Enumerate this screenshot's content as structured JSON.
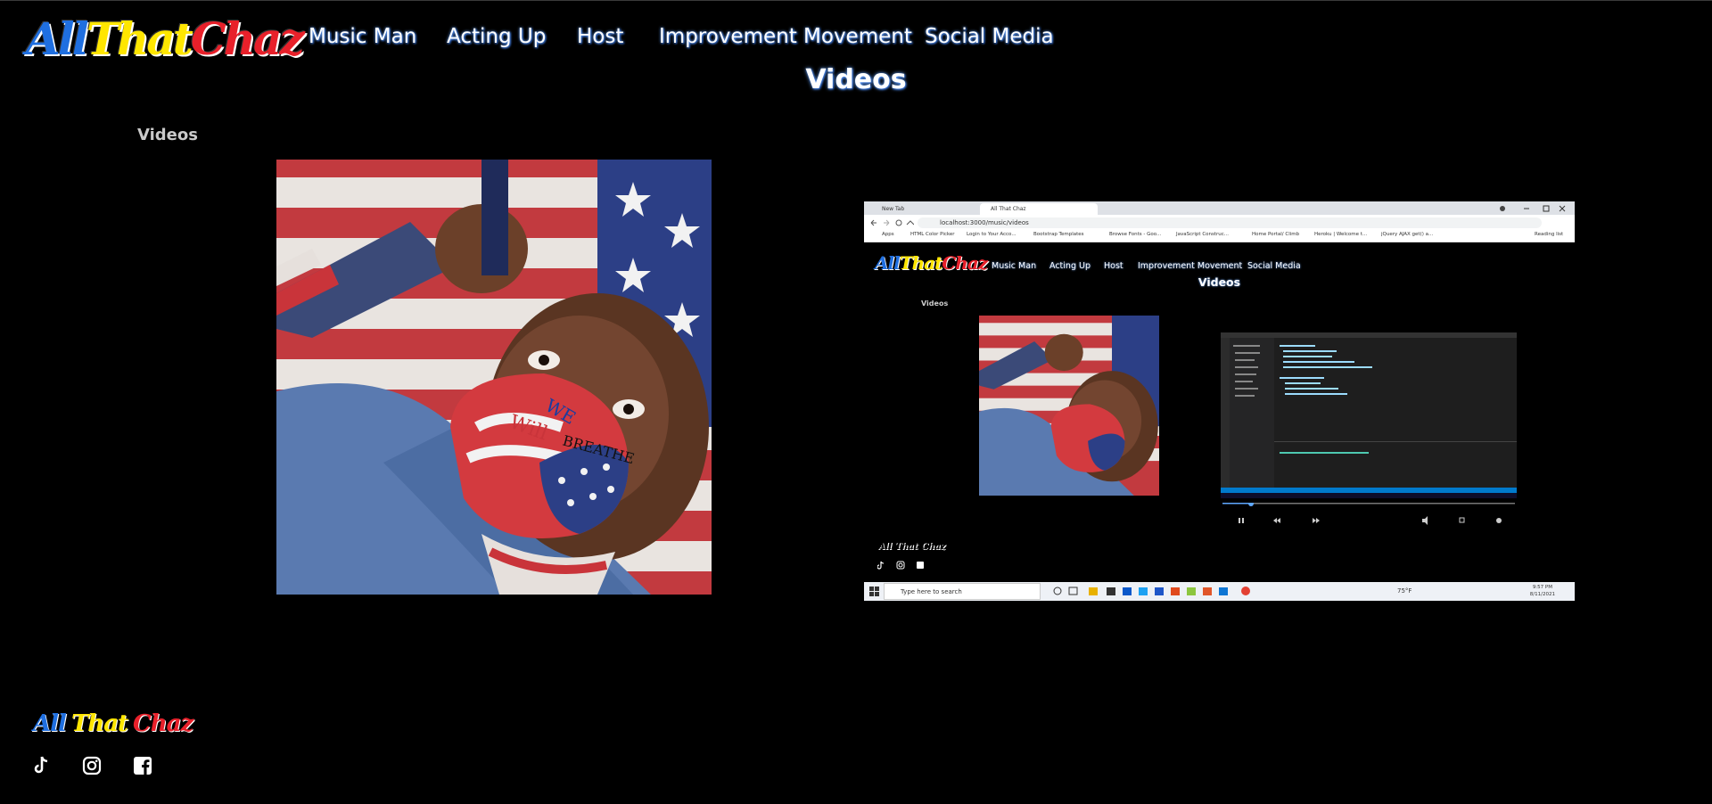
{
  "brand": {
    "part1": "All",
    "part2": "That",
    "part3": "Chaz"
  },
  "nav": {
    "items": [
      {
        "label": "Music Man"
      },
      {
        "label": "Acting Up"
      },
      {
        "label": "Host"
      },
      {
        "label": "Improvement Movement"
      },
      {
        "label": "Social Media"
      }
    ]
  },
  "page": {
    "title": "Videos",
    "section_label": "Videos"
  },
  "footer": {
    "brand": {
      "part1": "All",
      "part2": "That",
      "part3": "Chaz"
    },
    "icons": [
      "tiktok-icon",
      "instagram-icon",
      "facebook-icon"
    ]
  },
  "video_thumbnail": {
    "tabs": [
      {
        "label": "New Tab"
      },
      {
        "label": "All That Chaz"
      }
    ],
    "url": "localhost:3000/music/videos",
    "bookmarks": [
      "Apps",
      "HTML Color Picker",
      "Login to Your Acco...",
      "Bootstrap Templates",
      "Browse Fonts - Goo...",
      "JavaScript Construc...",
      "Home Portal/ Climb",
      "Heroku | Welcome t...",
      "jQuery AJAX get() a..."
    ],
    "reading_list": "Reading list",
    "nav": [
      "Music Man",
      "Acting Up",
      "Host",
      "Improvement Movement",
      "Social Media"
    ],
    "title": "Videos",
    "section_label": "Videos",
    "footer_brand": "All That Chaz",
    "taskbar_search": "Type here to search",
    "weather": "75°F",
    "time": "9:57 PM",
    "date": "8/11/2021"
  },
  "colors": {
    "brand_blue": "#1f6fe0",
    "brand_yellow": "#ffe600",
    "brand_red": "#e8202a",
    "nav_glow": "#6aa7ff"
  }
}
